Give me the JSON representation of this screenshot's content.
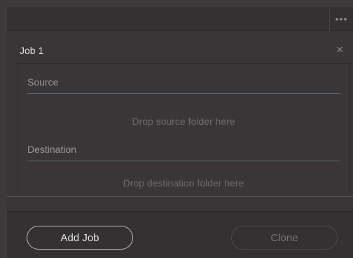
{
  "toolbar": {
    "more_icon_glyph": "•••"
  },
  "job": {
    "title": "Job 1",
    "close_glyph": "×",
    "source": {
      "label": "Source",
      "placeholder": "Drop source folder here"
    },
    "destination": {
      "label": "Destination",
      "placeholder": "Drop destination folder here"
    }
  },
  "footer": {
    "add_job_label": "Add Job",
    "clone_label": "Clone"
  },
  "colors": {
    "background": "#3e3a3b",
    "panel": "#3a3637",
    "field_underline": "#5a6a7a",
    "muted_text": "#6f6b6c"
  }
}
